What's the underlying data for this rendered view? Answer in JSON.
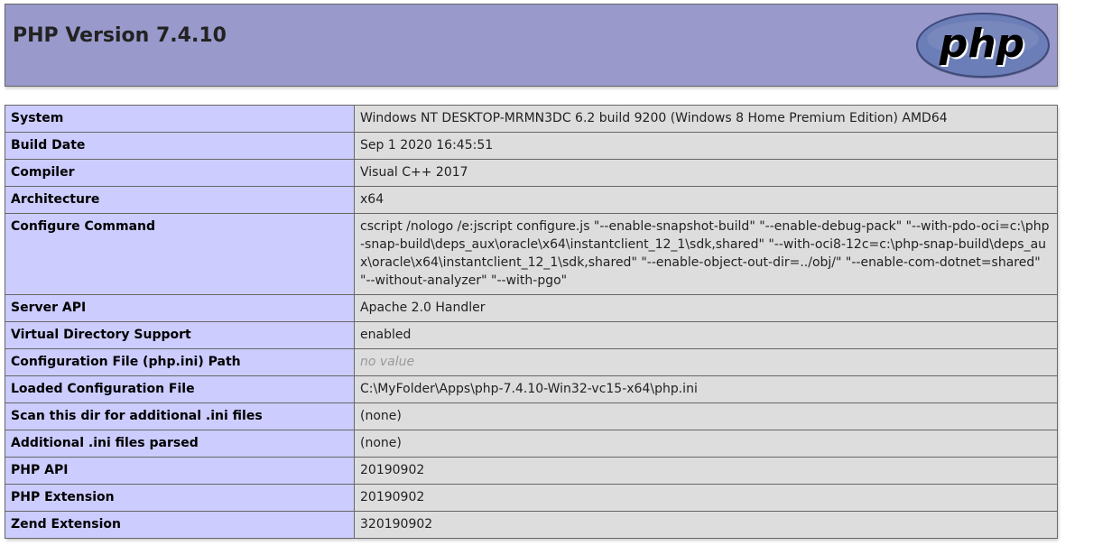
{
  "header": {
    "title": "PHP Version 7.4.10",
    "logo_text": "php",
    "bg_color": "#9999cc"
  },
  "rows": [
    {
      "key": "System",
      "value": "Windows NT DESKTOP-MRMN3DC 6.2 build 9200 (Windows 8 Home Premium Edition) AMD64"
    },
    {
      "key": "Build Date",
      "value": "Sep 1 2020 16:45:51"
    },
    {
      "key": "Compiler",
      "value": "Visual C++ 2017"
    },
    {
      "key": "Architecture",
      "value": "x64"
    },
    {
      "key": "Configure Command",
      "value": "cscript /nologo /e:jscript configure.js \"--enable-snapshot-build\" \"--enable-debug-pack\" \"--with-pdo-oci=c:\\php-snap-build\\deps_aux\\oracle\\x64\\instantclient_12_1\\sdk,shared\" \"--with-oci8-12c=c:\\php-snap-build\\deps_aux\\oracle\\x64\\instantclient_12_1\\sdk,shared\" \"--enable-object-out-dir=../obj/\" \"--enable-com-dotnet=shared\" \"--without-analyzer\" \"--with-pgo\""
    },
    {
      "key": "Server API",
      "value": "Apache 2.0 Handler"
    },
    {
      "key": "Virtual Directory Support",
      "value": "enabled"
    },
    {
      "key": "Configuration File (php.ini) Path",
      "value": "no value"
    },
    {
      "key": "Loaded Configuration File",
      "value": "C:\\MyFolder\\Apps\\php-7.4.10-Win32-vc15-x64\\php.ini"
    },
    {
      "key": "Scan this dir for additional .ini files",
      "value": "(none)"
    },
    {
      "key": "Additional .ini files parsed",
      "value": "(none)"
    },
    {
      "key": "PHP API",
      "value": "20190902"
    },
    {
      "key": "PHP Extension",
      "value": "20190902"
    },
    {
      "key": "Zend Extension",
      "value": "320190902"
    }
  ]
}
